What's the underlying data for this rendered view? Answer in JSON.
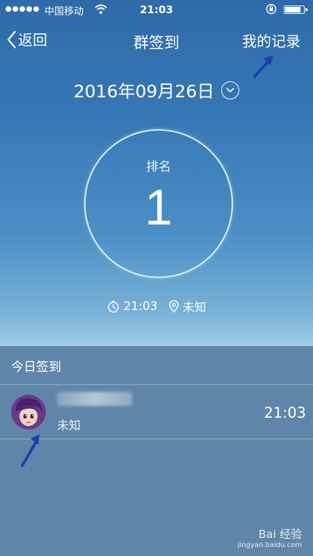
{
  "status_bar": {
    "carrier": "中国移动",
    "time": "21:03",
    "battery_level": 0.9
  },
  "nav": {
    "back_label": "返回",
    "title": "群签到",
    "right_label": "我的记录"
  },
  "date": {
    "text": "2016年09月26日"
  },
  "rank": {
    "label": "排名",
    "value": "1"
  },
  "meta": {
    "time": "21:03",
    "location": "未知"
  },
  "today": {
    "title": "今日签到",
    "records": [
      {
        "name": "",
        "location": "未知",
        "time": "21:03"
      }
    ]
  },
  "watermark": {
    "brand": "Bai 经验",
    "url": "jingyan.baidu.com"
  },
  "colors": {
    "bg_top": "#2f6aa8",
    "bg_bottom": "#9fcbe8",
    "panel": "#5f86a9",
    "annotation_arrow": "#1a3fb0"
  }
}
